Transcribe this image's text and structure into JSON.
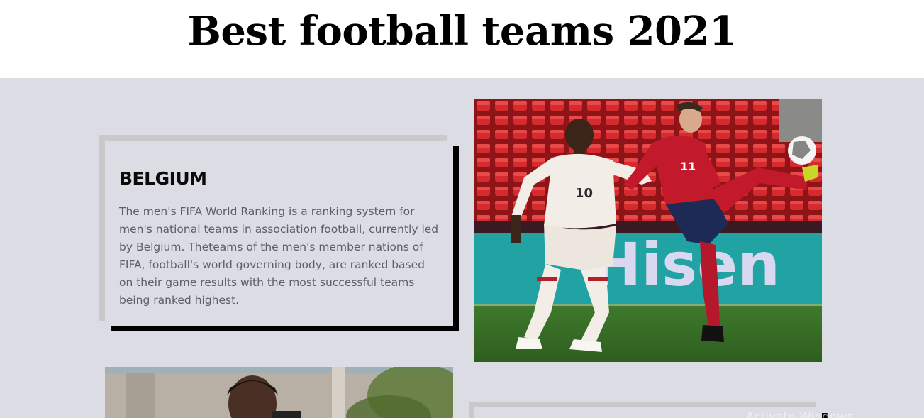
{
  "header": {
    "title": "Best football teams 2021"
  },
  "cards": [
    {
      "name": "BELGIUM",
      "description": "The men's FIFA World Ranking is a ranking system for men's national teams in association football, currently led by Belgium. Theteams of the men's member nations of FIFA, football's world governing body, are ranked based on their game results with the most successful teams being ranked highest."
    }
  ],
  "photo_main": {
    "board_text": "Hisen",
    "player_left_number": "10",
    "player_right_number": "11"
  },
  "watermark": {
    "text": "Activate Windows"
  },
  "colors": {
    "page_bg": "#dcdce5",
    "frame_light": "#c9c9c9",
    "frame_dark": "#000000",
    "title": "#000000",
    "description": "#5e5e66"
  }
}
